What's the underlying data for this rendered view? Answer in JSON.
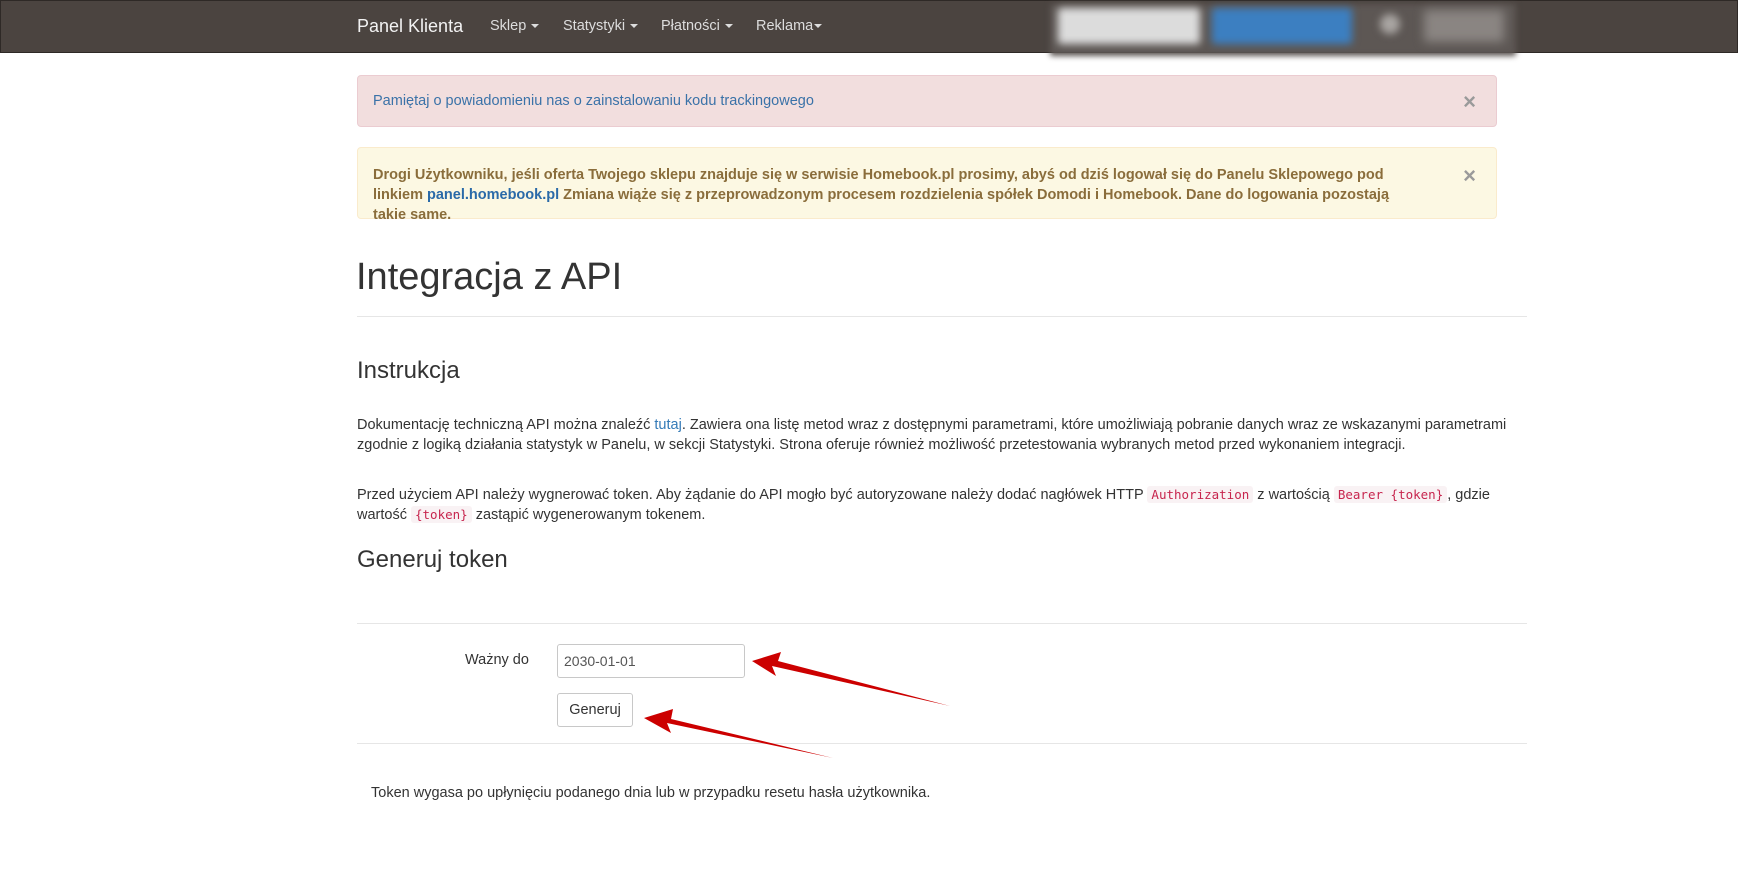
{
  "navbar": {
    "brand": "Panel Klienta",
    "items": [
      {
        "label": "Sklep"
      },
      {
        "label": "Statystyki"
      },
      {
        "label": "Płatności"
      },
      {
        "label": "Reklama"
      }
    ]
  },
  "alerts": {
    "tracking": "Pamiętaj o powiadomieniu nas o zainstalowaniu kodu trackingowego",
    "homebook_part1": "Drogi Użytkowniku, jeśli oferta Twojego sklepu znajduje się w serwisie Homebook.pl prosimy, abyś od dziś logował się do Panelu Sklepowego pod linkiem ",
    "homebook_link": "panel.homebook.pl",
    "homebook_part2": " Zmiana wiąże się z przeprowadzonym procesem rozdzielenia spółek Domodi i Homebook. Dane do logowania pozostają takie same.",
    "close_symbol": "×"
  },
  "page": {
    "title": "Integracja z API",
    "instruction_heading": "Instrukcja",
    "para1_before": "Dokumentację techniczną API można znaleźć ",
    "para1_link": "tutaj",
    "para1_after": ". Zawiera ona listę metod wraz z dostępnymi parametrami, które umożliwiają pobranie danych wraz ze wskazanymi parametrami zgodnie z logiką działania statystyk w Panelu, w sekcji Statystyki. Strona oferuje również możliwość przetestowania wybranych metod przed wykonaniem integracji.",
    "para2_a": "Przed użyciem API należy wygnerować token. Aby żądanie do API mogło być autoryzowane należy dodać nagłówek HTTP ",
    "code_auth": "Authorization",
    "para2_b": " z wartością ",
    "code_bearer": "Bearer {token}",
    "para2_c": ", gdzie wartość ",
    "code_token": "{token}",
    "para2_d": " zastąpić wygenerowanym tokenem.",
    "token_heading": "Generuj token",
    "valid_label": "Ważny do",
    "valid_value": "2030-01-01",
    "generate_button": "Generuj",
    "expiry_note": "Token wygasa po upłynięciu podanego dnia lub w przypadku resetu hasła użytkownika."
  },
  "colors": {
    "navbar_bg": "#4b4440",
    "danger_bg": "#f2dede",
    "warning_bg": "#fcf8e3",
    "link": "#337ab7",
    "annotation_arrow": "#cc0000"
  }
}
